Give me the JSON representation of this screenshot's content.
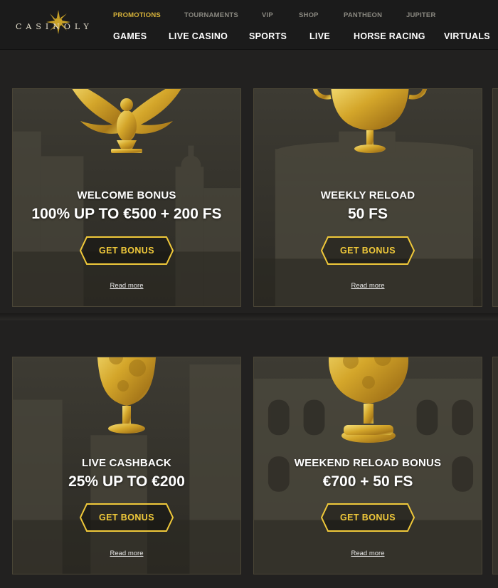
{
  "header": {
    "logo_text": "CASINOLY",
    "top_nav": [
      {
        "label": "PROMOTIONS",
        "active": true
      },
      {
        "label": "TOURNAMENTS",
        "active": false
      },
      {
        "label": "VIP",
        "active": false
      },
      {
        "label": "SHOP",
        "active": false
      },
      {
        "label": "PANTHEON",
        "active": false
      },
      {
        "label": "JUPITER",
        "active": false
      }
    ],
    "main_nav": [
      {
        "label": "GAMES"
      },
      {
        "label": "LIVE CASINO"
      },
      {
        "label": "SPORTS"
      },
      {
        "label": "LIVE"
      },
      {
        "label": "HORSE RACING"
      },
      {
        "label": "VIRTUALS"
      }
    ]
  },
  "promotions": [
    {
      "title": "WELCOME BONUS",
      "offer": "100% UP TO €500 + 200 FS",
      "button": "GET BONUS",
      "link": "Read more",
      "icon": "eagle-icon"
    },
    {
      "title": "WEEKLY RELOAD",
      "offer": "50 FS",
      "button": "GET BONUS",
      "link": "Read more",
      "icon": "kantharos-cup-icon"
    },
    {
      "title": "LIVE CASHBACK",
      "offer": "25% UP TO €200",
      "button": "GET BONUS",
      "link": "Read more",
      "icon": "goblet-icon"
    },
    {
      "title": "WEEKEND RELOAD BONUS",
      "offer": "€700 + 50 FS",
      "button": "GET BONUS",
      "link": "Read more",
      "icon": "chalice-icon"
    }
  ],
  "colors": {
    "accent_gold": "#f0c93a",
    "active_nav": "#d6b23a",
    "header_bg": "#1b1b1b",
    "page_bg": "#222120"
  }
}
